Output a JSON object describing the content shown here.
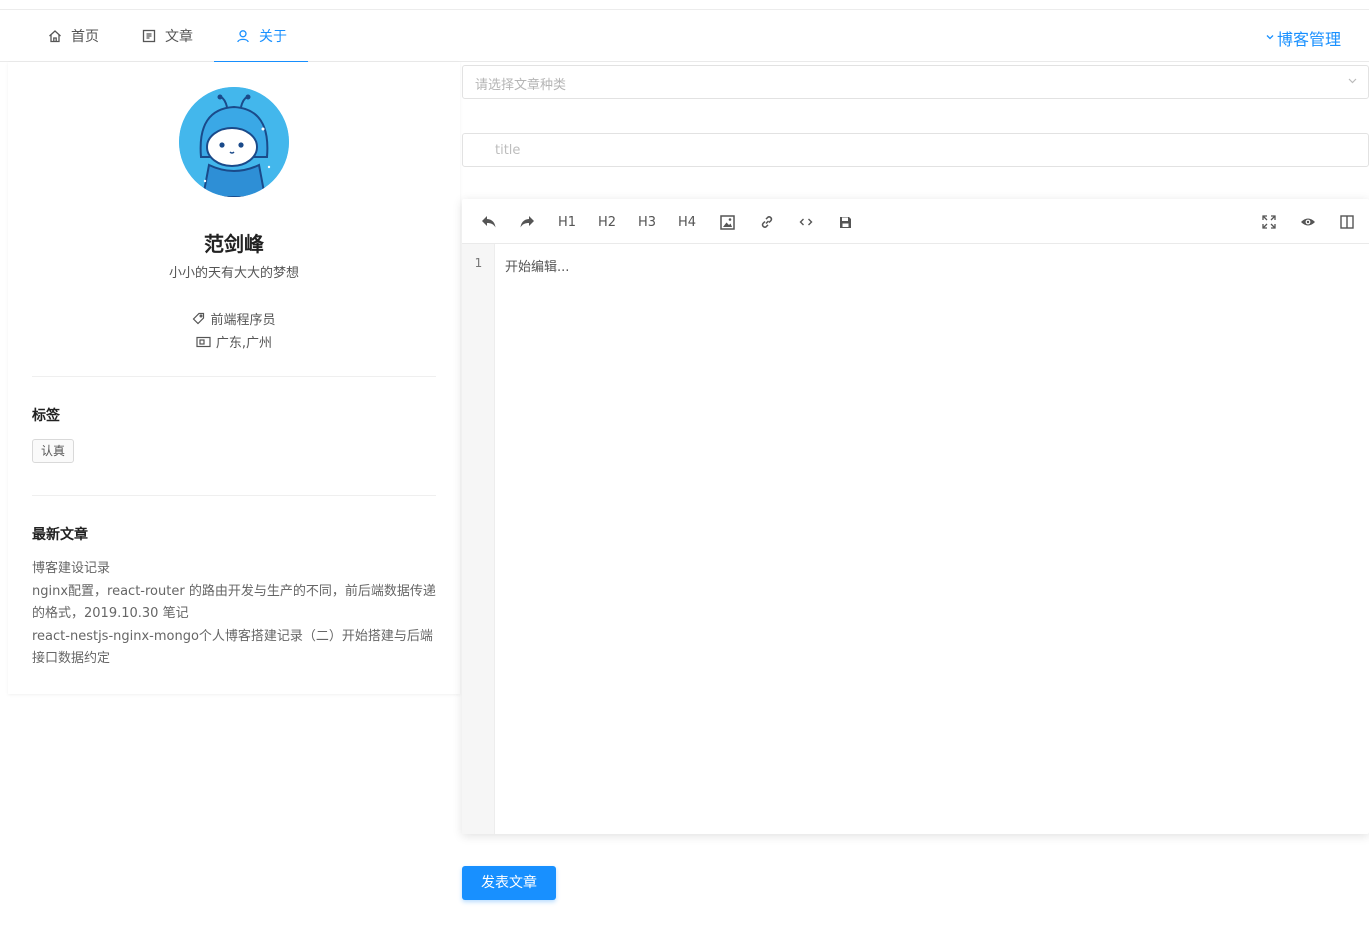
{
  "nav": {
    "items": [
      {
        "label": "首页",
        "icon": "home-icon"
      },
      {
        "label": "文章",
        "icon": "article-icon"
      },
      {
        "label": "关于",
        "icon": "user-icon",
        "active": true
      }
    ],
    "blog_admin": "博客管理"
  },
  "profile": {
    "name": "范剑峰",
    "motto": "小小的天有大大的梦想",
    "job": "前端程序员",
    "location": "广东,广州"
  },
  "tags_section": {
    "title": "标签",
    "tags": [
      "认真"
    ]
  },
  "latest_section": {
    "title": "最新文章",
    "articles": [
      "博客建设记录",
      "nginx配置，react-router 的路由开发与生产的不同，前后端数据传递的格式，2019.10.30 笔记",
      "react-nestjs-nginx-mongo个人博客搭建记录（二）开始搭建与后端接口数据约定"
    ]
  },
  "form": {
    "category_placeholder": "请选择文章种类",
    "title_placeholder": "title"
  },
  "editor": {
    "toolbar": {
      "h1": "H1",
      "h2": "H2",
      "h3": "H3",
      "h4": "H4"
    },
    "line_number": "1",
    "placeholder": "开始编辑..."
  },
  "publish_button": "发表文章",
  "colors": {
    "accent": "#1890ff",
    "avatar_bg": "#43b7ec"
  }
}
